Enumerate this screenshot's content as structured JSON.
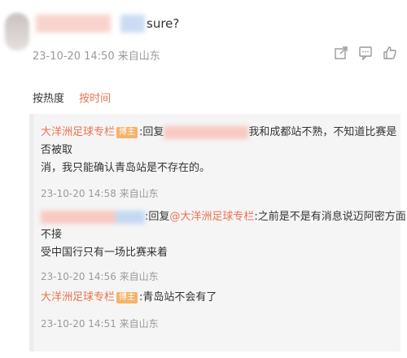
{
  "post": {
    "text_suffix": "sure?",
    "meta": "23-10-20 14:50 来自山东",
    "actions": [
      {
        "name": "share-icon"
      },
      {
        "name": "comment-icon"
      },
      {
        "name": "like-icon"
      }
    ]
  },
  "sort": {
    "options": [
      {
        "label": "按热度"
      },
      {
        "label": "按时间"
      }
    ]
  },
  "replies": [
    {
      "name": "大洋洲足球专栏",
      "badge": "博主",
      "prefix": ":回复",
      "text_line1": "我和成都站不熟，不知道比赛是否被取",
      "text_line2": "消，我只能确认青岛站是不存在的。",
      "meta": "23-10-20 14:58 来自山东"
    },
    {
      "prefix": ":回复",
      "mention": "@大洋洲足球专栏",
      "text_line1": ":之前是不是有消息说迈阿密方面不接",
      "text_line2": "受中国行只有一场比赛来着",
      "meta": "23-10-20 14:56 来自山东"
    },
    {
      "name": "大洋洲足球专栏",
      "badge": "博主",
      "text": ":青岛站不会有了",
      "meta": "23-10-20 14:51 来自山东"
    }
  ]
}
